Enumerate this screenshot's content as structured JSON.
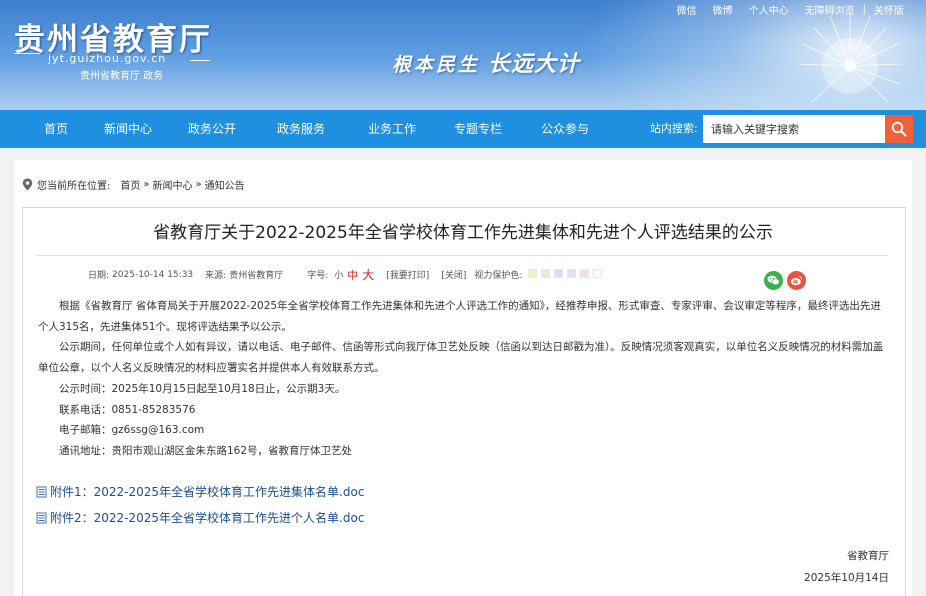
{
  "header": {
    "site_title": "贵州省教育厅",
    "domain": "jyt.guizhou.gov.cn",
    "subtitle": "贵州省教育厅 政务",
    "slogan_part1": "根本民生",
    "slogan_part2": "长远大计",
    "top_links": [
      "微信",
      "微博",
      "个人中心",
      "无障碍浏览",
      "关怀版"
    ],
    "top_sep": "|"
  },
  "nav": {
    "items": [
      "首页",
      "新闻中心",
      "政务公开",
      "政务服务",
      "业务工作",
      "专题专栏",
      "公众参与"
    ],
    "search_label": "站内搜索:",
    "search_value": "请输入关键字搜索"
  },
  "breadcrumb": {
    "prefix": "您当前所在位置:",
    "items": [
      "首页",
      "新闻中心",
      "通知公告"
    ],
    "separator": "»"
  },
  "article": {
    "title": "省教育厅关于2022-2025年全省学校体育工作先进集体和先进个人评选结果的公示",
    "meta": {
      "date_label": "日期:",
      "date": "2025-10-14 15:33",
      "source_label": "来源:",
      "source": "贵州省教育厅",
      "fontsize_label": "字号:",
      "size_small": "小",
      "size_mid": "中",
      "size_big": "大",
      "print": "[我要打印]",
      "close": "[关闭]",
      "eye_label": "视力保护色:",
      "swatches": [
        "#f9f1bd",
        "#e1ecd9",
        "#d5e3f0",
        "#e7dff0",
        "#f3dcef",
        "#ffffff"
      ]
    },
    "paragraphs": [
      "根据《省教育厅 省体育局关于开展2022-2025年全省学校体育工作先进集体和先进个人评选工作的通知》，经推荐申报、形式审查、专家评审、会议审定等程序，最终评选出先进个人315名，先进集体51个。现将评选结果予以公示。",
      "公示期间，任何单位或个人如有异议，请以电话、电子邮件、信函等形式向我厅体卫艺处反映（信函以到达日邮戳为准）。反映情况须客观真实，以单位名义反映情况的材料需加盖单位公章，以个人名义反映情况的材料应署实名并提供本人有效联系方式。",
      "公示时间：2025年10月15日起至10月18日止，公示期3天。",
      "联系电话：0851-85283576",
      "电子邮箱：gz6ssg@163.com",
      "通讯地址：贵阳市观山湖区金朱东路162号，省教育厅体卫艺处"
    ],
    "attachments": [
      "附件1：2022-2025年全省学校体育工作先进集体名单.doc",
      "附件2：2022-2025年全省学校体育工作先进个人名单.doc"
    ],
    "signature_org": "省教育厅",
    "signature_date": "2025年10月14日"
  },
  "colors": {
    "nav_bg": "#1f8fe0",
    "search_btn": "#f0603b",
    "wechat": "#3bb04a",
    "weibo": "#e8523f",
    "link": "#1c4e8f"
  },
  "icons": [
    "location-pin-icon",
    "search-icon",
    "wechat-icon",
    "weibo-icon",
    "document-icon"
  ]
}
